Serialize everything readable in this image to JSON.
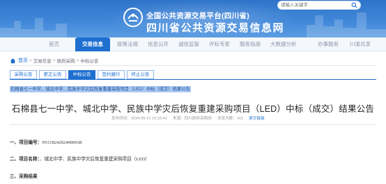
{
  "header": {
    "title_top": "全国公共资源交易平台(四川省)",
    "title_main": "四川省公共资源交易信息网",
    "search": {
      "placeholder": "请输入关键字"
    }
  },
  "nav": {
    "items": [
      "首页",
      "交易信息",
      "政策法规",
      "信息公开",
      "诚信监管",
      "评标专家",
      "服务指南",
      "大数据分析",
      "办事服务",
      "川渝共享"
    ],
    "active_index": 1
  },
  "breadcrumb": {
    "home": "首页",
    "items": [
      "交易信息",
      "政府采购",
      "中标公告"
    ],
    "separator": ">"
  },
  "tabs": {
    "items": [
      "采购公告",
      "更正公告",
      "中标公告",
      "签约履行",
      "终止公告"
    ],
    "active_index": 2
  },
  "article": {
    "selected_title": "石棉县七一中学、城北中学、民族中学灾后恢复重建采购项目（LED）中标（成交）结果公告",
    "title": "石棉县七一中学、城北中学、民族中学灾后恢复重建采购项目（LED）中标（成交）结果公告",
    "meta": {
      "published": "发布时间：2024-05-21 15:10:41",
      "source": "来源：四川政府采购网",
      "views": "浏览次数：161",
      "original_link": "原文链接"
    },
    "sections": [
      {
        "label": "一、项目编号：",
        "value": "N5118242024000038"
      },
      {
        "label": "二、项目名称：",
        "value": "、城北中学、民族中学灾后恢复重建采购项目（LED）"
      },
      {
        "label": "三、采购结果",
        "value": ""
      }
    ]
  },
  "colors": {
    "primary": "#1f6fd1",
    "banner": "#3f86d8",
    "highlight": "#a8c8f0"
  }
}
